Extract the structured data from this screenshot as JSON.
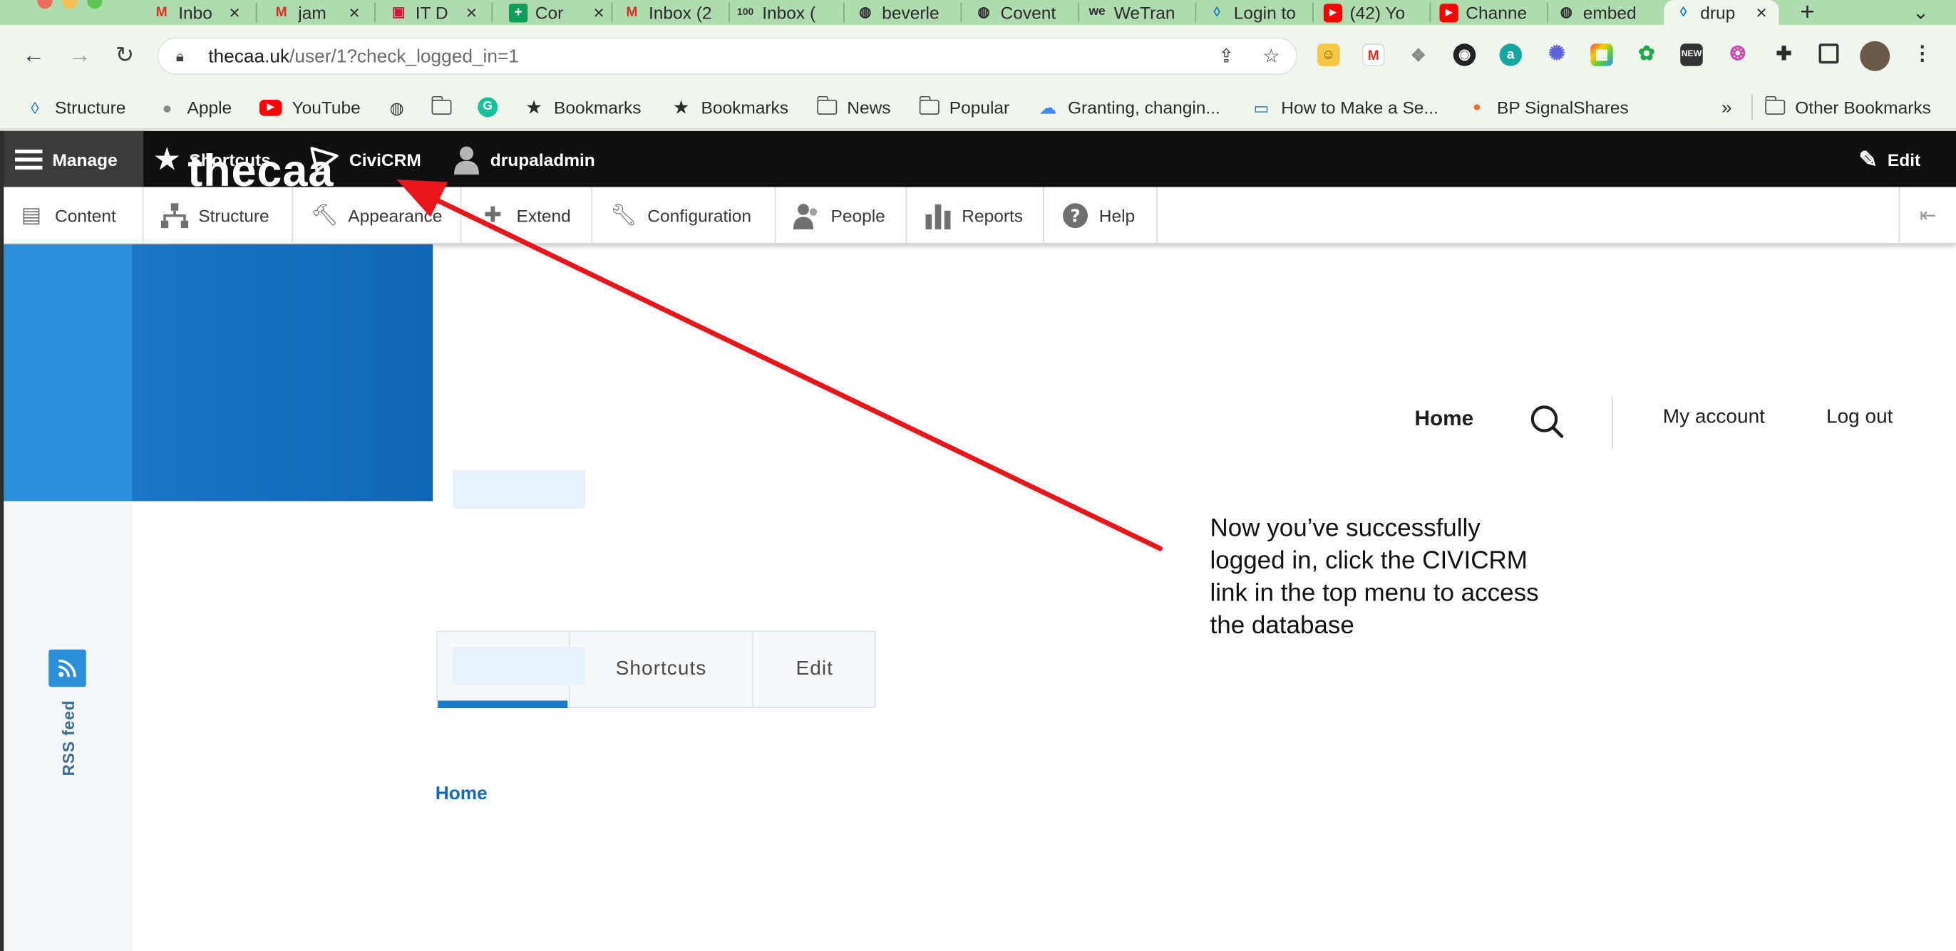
{
  "browser": {
    "tabs": [
      {
        "title": "Inbo",
        "icon": "gmail-icon"
      },
      {
        "title": "jam",
        "icon": "gmail-icon"
      },
      {
        "title": "IT D",
        "icon": "it-icon"
      },
      {
        "title": "Cor",
        "icon": "sheets-icon"
      },
      {
        "title": "Inbox (2",
        "icon": "gmail-icon"
      },
      {
        "title": "Inbox (",
        "icon": "inbox-100-icon"
      },
      {
        "title": "beverle",
        "icon": "globe-icon"
      },
      {
        "title": "Covent",
        "icon": "globe-icon"
      },
      {
        "title": "WeTran",
        "icon": "wetransfer-icon"
      },
      {
        "title": "Login to",
        "icon": "drupal-icon"
      },
      {
        "title": "(42) Yo",
        "icon": "youtube-icon"
      },
      {
        "title": "Channe",
        "icon": "youtube-icon"
      },
      {
        "title": "embed",
        "icon": "globe-icon"
      },
      {
        "title": "drup",
        "icon": "drupal-icon",
        "active": true
      }
    ],
    "new_tab_label": "+",
    "tab_menu_label": "⌄",
    "address": {
      "host": "thecaa.uk",
      "path": "/user/1?check_logged_in=1"
    },
    "bookmarks": [
      {
        "label": "Structure",
        "icon": "drupal-icon"
      },
      {
        "label": "Apple",
        "icon": "apple-icon"
      },
      {
        "label": "YouTube",
        "icon": "youtube-icon"
      },
      {
        "label": "",
        "icon": "globe-icon"
      },
      {
        "label": "",
        "icon": "folder-icon"
      },
      {
        "label": "",
        "icon": "grammarly-icon"
      },
      {
        "label": "Bookmarks",
        "icon": "star-icon"
      },
      {
        "label": "Bookmarks",
        "icon": "star-icon"
      },
      {
        "label": "News",
        "icon": "folder-icon"
      },
      {
        "label": "Popular",
        "icon": "folder-icon"
      },
      {
        "label": "Granting, changin...",
        "icon": "google-cloud-icon"
      },
      {
        "label": "How to Make a Se...",
        "icon": "webpage-icon"
      },
      {
        "label": "BP SignalShares",
        "icon": "dot-icon"
      }
    ],
    "bookmarks_overflow": "»",
    "other_bookmarks": "Other Bookmarks"
  },
  "admin_bar": {
    "manage": "Manage",
    "shortcuts": "Shortcuts",
    "civicrm": "CiviCRM",
    "user": "drupaladmin",
    "edit": "Edit"
  },
  "tray": {
    "items": [
      {
        "label": "Content",
        "icon": "content-icon"
      },
      {
        "label": "Structure",
        "icon": "structure-icon"
      },
      {
        "label": "Appearance",
        "icon": "appearance-icon"
      },
      {
        "label": "Extend",
        "icon": "extend-icon"
      },
      {
        "label": "Configuration",
        "icon": "configuration-icon"
      },
      {
        "label": "People",
        "icon": "people-icon"
      },
      {
        "label": "Reports",
        "icon": "reports-icon"
      },
      {
        "label": "Help",
        "icon": "help-icon"
      }
    ]
  },
  "site": {
    "name": "thecaa",
    "nav": {
      "home": "Home",
      "my_account": "My account",
      "log_out": "Log out"
    },
    "user_tabs": {
      "shortcuts": "Shortcuts",
      "edit": "Edit"
    },
    "breadcrumb_home": "Home",
    "rss_label": "RSS feed"
  },
  "annotation": {
    "lines": [
      "Now you’ve successfully",
      "logged in, click the CIVICRM",
      "link in the top menu to access",
      "the database"
    ],
    "arrow_color": "#e8151b"
  }
}
